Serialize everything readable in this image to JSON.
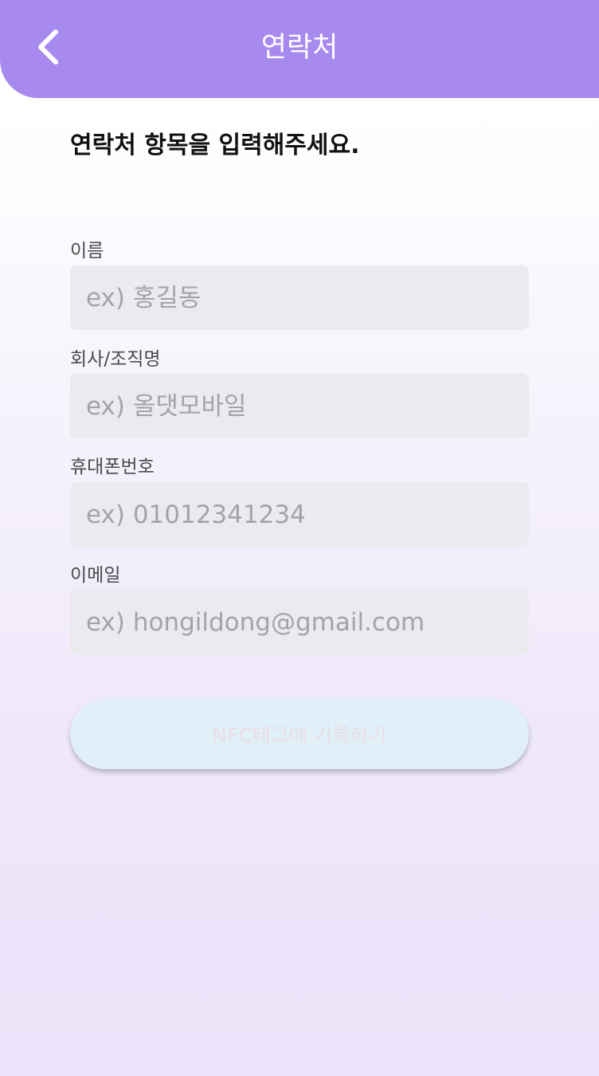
{
  "header": {
    "title": "연락처",
    "back_icon": "chevron-left-icon",
    "background_color": "#a88aee"
  },
  "instruction": "연락처 항목을 입력해주세요.",
  "form": {
    "fields": [
      {
        "label": "이름",
        "placeholder": "ex) 홍길동",
        "value": ""
      },
      {
        "label": "회사/조직명",
        "placeholder": "ex) 올댓모바일",
        "value": ""
      },
      {
        "label": "휴대폰번호",
        "placeholder": "ex) 01012341234",
        "value": ""
      },
      {
        "label": "이메일",
        "placeholder": "ex) hongildong@gmail.com",
        "value": ""
      }
    ],
    "submit_label": "NFC태그에 기록하기",
    "submit_disabled": true
  }
}
